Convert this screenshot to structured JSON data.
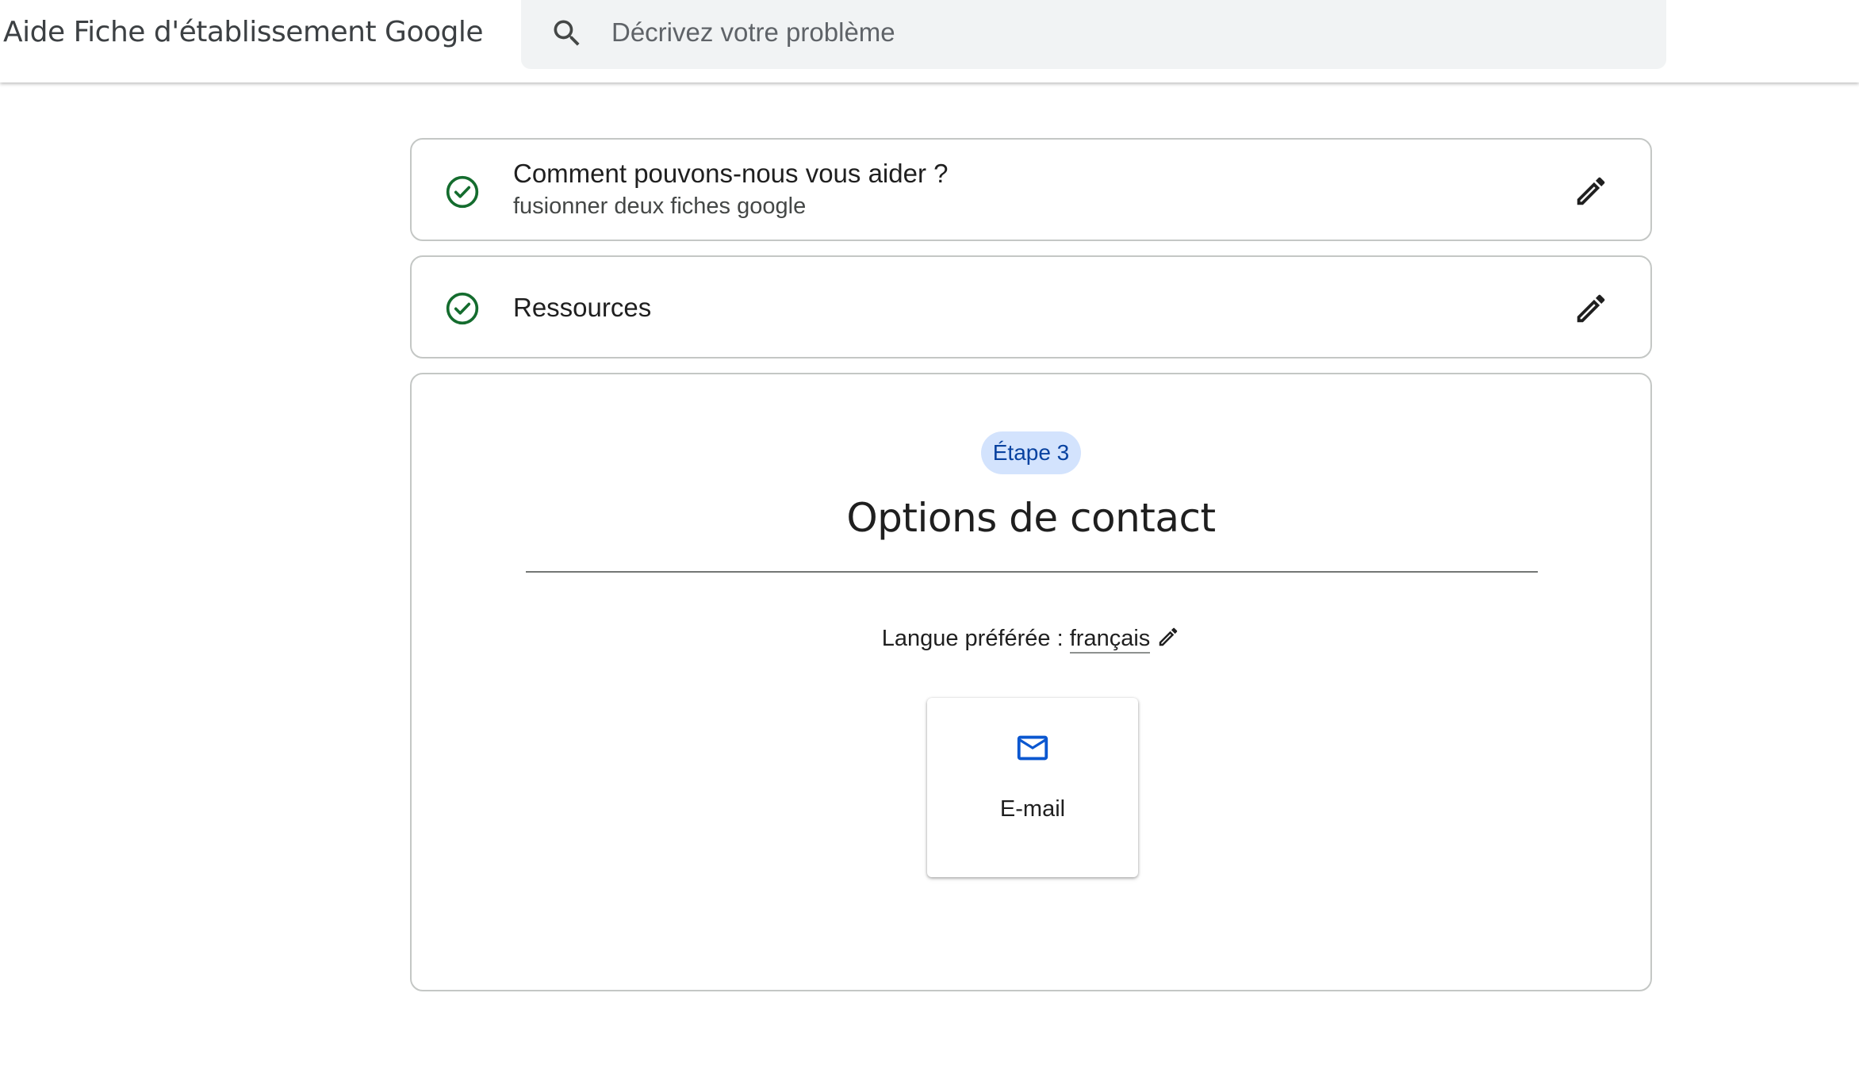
{
  "header": {
    "app_title": "Aide Fiche d'établissement Google",
    "search": {
      "placeholder": "Décrivez votre problème",
      "value": ""
    }
  },
  "steps": [
    {
      "title": "Comment pouvons-nous vous aider ?",
      "subtitle": "fusionner deux fiches google",
      "status": "completed"
    },
    {
      "title": "Ressources",
      "status": "completed"
    }
  ],
  "current_step": {
    "chip": "Étape 3",
    "heading": "Options de contact",
    "language_label": "Langue préférée : ",
    "language_value": "français",
    "contact_options": [
      {
        "label": "E-mail",
        "icon": "mail-icon"
      }
    ]
  },
  "colors": {
    "check_green": "#146c2e",
    "chip_bg": "#d3e3fd",
    "chip_text": "#0842a0",
    "mail_blue": "#0b57d0"
  }
}
